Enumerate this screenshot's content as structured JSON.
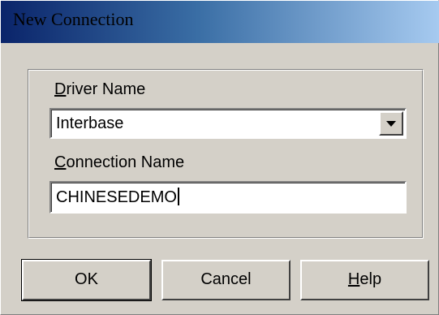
{
  "window": {
    "title": "New Connection"
  },
  "form": {
    "driver_label_key": "D",
    "driver_label_rest": "river Name",
    "driver_value": "Interbase",
    "connection_label_key": "C",
    "connection_label_rest": "onnection Name",
    "connection_value": "CHINESEDEMO"
  },
  "buttons": {
    "ok_label": "OK",
    "cancel_label": "Cancel",
    "help_label_key": "H",
    "help_label_rest": "elp"
  },
  "icons": {
    "dropdown": "chevron-down-icon"
  },
  "colors": {
    "face": "#d4d0c8",
    "title_start": "#0a246a",
    "title_end": "#a6caf0"
  }
}
